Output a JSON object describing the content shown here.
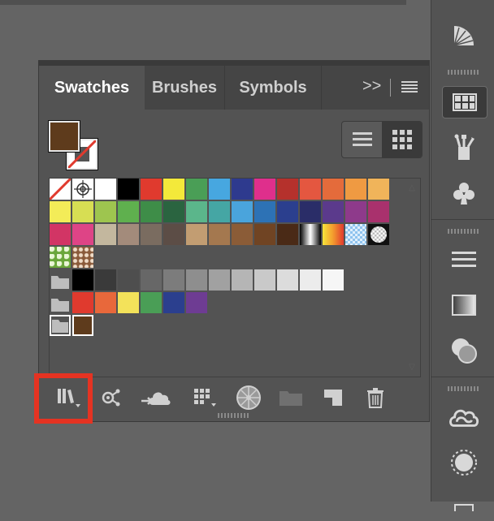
{
  "panel": {
    "tabs": [
      {
        "label": "Swatches",
        "active": true
      },
      {
        "label": "Brushes",
        "active": false
      },
      {
        "label": "Symbols",
        "active": false
      }
    ],
    "expand_label": ">>",
    "fill_color": "#5e3b1c",
    "stroke": "none"
  },
  "view_modes": [
    "list-view-icon",
    "grid-view-icon"
  ],
  "swatches": {
    "row1": [
      "none",
      "registration",
      "#ffffff",
      "#000000",
      "#e03a2e",
      "#f3e93a",
      "#4a9e56",
      "#47a7e0",
      "#2e3a8e",
      "#df2f8c",
      "#b5312c",
      "#e45740",
      "#e46b3b",
      "#ef9a42",
      "#f0b45a"
    ],
    "row2": [
      "#f3ec58",
      "#d7de53",
      "#9ec54f",
      "#5fb04e",
      "#3e8d48",
      "#2a6440",
      "#5bb68b",
      "#45a6a4",
      "#4aa4dc",
      "#2d72b5",
      "#2b3f8e",
      "#2a2d68",
      "#5b3a8c",
      "#8e3a8b",
      "#a9316d"
    ],
    "row3": [
      "#d23565",
      "#de4486",
      "#c3b79e",
      "#a38b7b",
      "#7a6c60",
      "#5c4d46",
      "#c29d72",
      "#a4784f",
      "#8b5c37",
      "#704423",
      "#4a2a16",
      "gradient-bw",
      "gradient-yellow",
      "gradient-blue-pattern",
      "radial"
    ],
    "row4": [
      "pattern-green",
      "pattern-brown"
    ],
    "grays": [
      "#000000",
      "#3a3a3a",
      "#4e4e4e",
      "#676767",
      "#7c7c7c",
      "#8e8e8e",
      "#a1a1a1",
      "#b5b5b5",
      "#c9c9c9",
      "#dcdcdc",
      "#ececec",
      "#f6f6f6"
    ],
    "brights": [
      "#e03a2e",
      "#e8683b",
      "#f3e25a",
      "#4a9e56",
      "#2b3f8e",
      "#6e3c93"
    ],
    "group3": [
      "#5e3b1c"
    ]
  },
  "bottom_tools": [
    "swatch-libraries-menu-icon",
    "show-swatch-kinds-icon",
    "cloud-library-icon",
    "swatch-options-icon",
    "color-group-icon",
    "new-color-group-icon",
    "new-swatch-icon",
    "delete-swatch-icon"
  ],
  "dock_icons": [
    "gradient-fan-icon",
    "swatches-icon",
    "brushes-icon",
    "symbols-icon",
    "align-icon",
    "gradient-icon",
    "transparency-icon",
    "creative-cloud-icon",
    "appearance-icon"
  ]
}
